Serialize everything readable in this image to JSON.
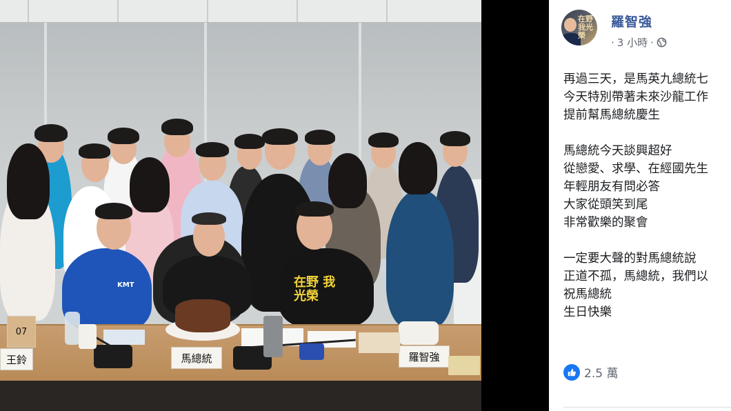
{
  "photo": {
    "nameplates": [
      "王鈴",
      "馬總統",
      "羅智強"
    ],
    "table_number": "07",
    "shirt_text": "在野 我光榮",
    "polo_logo": "KMT"
  },
  "post": {
    "author": "羅智強",
    "avatar_text": "在野 我光榮",
    "timestamp": "3 小時",
    "separator": "·",
    "body": [
      "再過三天，是馬英九總統七",
      "今天特別帶著未來沙龍工作",
      "提前幫馬總統慶生",
      "",
      "馬總統今天談興超好",
      "從戀愛、求學、在經國先生",
      "年輕朋友有問必答",
      "大家從頭笑到尾",
      "非常歡樂的聚會",
      "",
      "一定要大聲的對馬總統說",
      "正道不孤，馬總統，我們以",
      "祝馬總統",
      "生日快樂"
    ],
    "likes": "2.5 萬"
  },
  "colors": {
    "author": "#385898",
    "like": "#1877f2",
    "meta": "#606770"
  }
}
